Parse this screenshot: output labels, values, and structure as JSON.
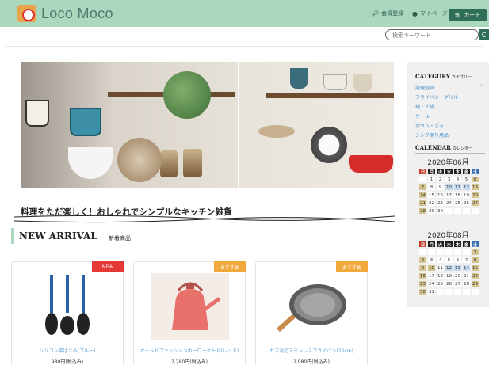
{
  "header": {
    "logo_text": "Loco Moco",
    "nav": [
      {
        "label": "会員登録",
        "icon": "key-icon"
      },
      {
        "label": "マイページ",
        "icon": "user-icon"
      }
    ],
    "cart_label": "カート",
    "colors": {
      "header_bg": "#a9d8bf",
      "accent": "#2f6f57"
    }
  },
  "search": {
    "placeholder": "検索キーワード",
    "button_label": "C"
  },
  "slogan": "料理をただ楽しく！おしゃれでシンプルなキッチン雑貨",
  "new_arrival": {
    "title": "NEW ARRIVAL",
    "subtitle": "新着商品"
  },
  "products": [
    {
      "badge": "NEW",
      "badge_color": "#e53935",
      "name": "シリコン菜ばさみ(ブルー)",
      "price": "980円(税込み)",
      "image": "ladle-set-icon"
    },
    {
      "badge": "おすすめ",
      "badge_color": "#f2a93b",
      "name": "オールドファッションホーローケトル(レッド)",
      "price": "2,280円(税込み)",
      "image": "enamel-kettle-icon"
    },
    {
      "badge": "おすすめ",
      "badge_color": "#f2a93b",
      "name": "ガス対応ステンレスフライパン(26cm)",
      "price": "2,980円(税込み)",
      "image": "frying-pan-icon"
    }
  ],
  "sidebar": {
    "category_title": "CATEGORY",
    "category_sub": "カテゴリー",
    "categories": [
      "調理道具",
      "フライパン・グリル",
      "鍋・土鍋",
      "ケトル",
      "ボウル・ざる",
      "シンク周り用品"
    ],
    "calendar_title": "CALENDAR",
    "calendar_sub": "カレンダー",
    "weekdays": [
      "日",
      "月",
      "火",
      "水",
      "木",
      "金",
      "土"
    ],
    "calendars": [
      {
        "month_label": "2020年06月",
        "days": [
          "",
          "1",
          "2",
          "3",
          "4",
          "5",
          "6",
          "7",
          "8",
          "9",
          "10",
          "11",
          "12",
          "13",
          "14",
          "15",
          "16",
          "17",
          "18",
          "19",
          "20",
          "21",
          "22",
          "23",
          "24",
          "25",
          "26",
          "27",
          "28",
          "29",
          "30",
          "",
          "",
          "",
          ""
        ],
        "marks": [
          "",
          "",
          "",
          "",
          "",
          "",
          "t",
          "t",
          "",
          "",
          "b",
          "b",
          "b",
          "t",
          "t",
          "",
          "",
          "",
          "",
          "",
          "t",
          "t",
          "",
          "",
          "",
          "",
          "",
          "t",
          "t",
          "",
          "",
          "",
          "",
          "",
          ""
        ]
      },
      {
        "month_label": "2020年08月",
        "days": [
          "",
          "",
          "",
          "",
          "",
          "",
          "1",
          "2",
          "3",
          "4",
          "5",
          "6",
          "7",
          "8",
          "9",
          "10",
          "11",
          "12",
          "13",
          "14",
          "15",
          "16",
          "17",
          "18",
          "19",
          "20",
          "21",
          "22",
          "23",
          "24",
          "25",
          "26",
          "27",
          "28",
          "29",
          "30",
          "31",
          "",
          "",
          "",
          "",
          ""
        ],
        "marks": [
          "",
          "",
          "",
          "",
          "",
          "",
          "t",
          "t",
          "",
          "",
          "",
          "",
          "",
          "t",
          "t",
          "t",
          "",
          "b",
          "b",
          "b",
          "t",
          "t",
          "",
          "",
          "",
          "",
          "",
          "t",
          "t",
          "",
          "",
          "",
          "",
          "",
          "t",
          "t",
          "",
          "",
          "",
          "",
          "",
          ""
        ]
      }
    ]
  }
}
